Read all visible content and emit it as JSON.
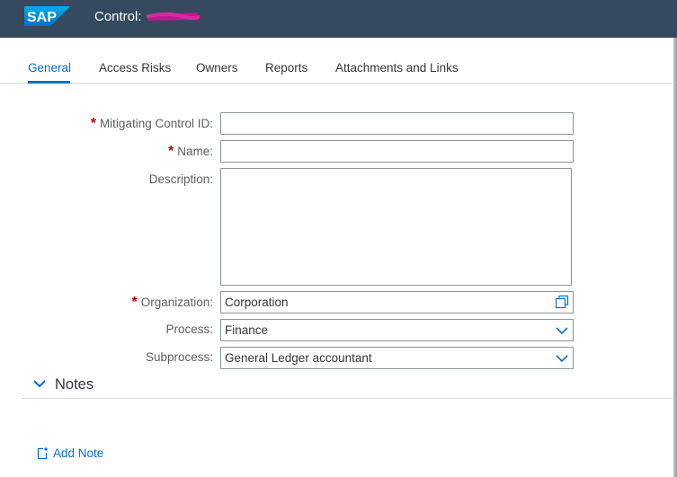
{
  "shell": {
    "logo_text": "SAP",
    "title_prefix": "Control:",
    "brand_color": "#354a5f"
  },
  "tabs": [
    {
      "label": "General",
      "selected": true
    },
    {
      "label": "Access Risks",
      "selected": false
    },
    {
      "label": "Owners",
      "selected": false
    },
    {
      "label": "Reports",
      "selected": false
    },
    {
      "label": "Attachments and Links",
      "selected": false
    }
  ],
  "form": {
    "required_marker": "*",
    "mitigating_control_id": {
      "label": "Mitigating Control ID:",
      "value": ""
    },
    "name": {
      "label": "Name:",
      "value": ""
    },
    "description": {
      "label": "Description:",
      "value": ""
    },
    "organization": {
      "label": "Organization:",
      "value": "Corporation",
      "icon": "value-help-icon"
    },
    "process": {
      "label": "Process:",
      "value": "Finance",
      "icon": "chevron-down-icon"
    },
    "subprocess": {
      "label": "Subprocess:",
      "value": "General Ledger accountant",
      "icon": "chevron-down-icon"
    }
  },
  "notes": {
    "title": "Notes",
    "add_label": "Add Note"
  },
  "colors": {
    "accent": "#0a6ed1",
    "required": "#bb0000"
  }
}
